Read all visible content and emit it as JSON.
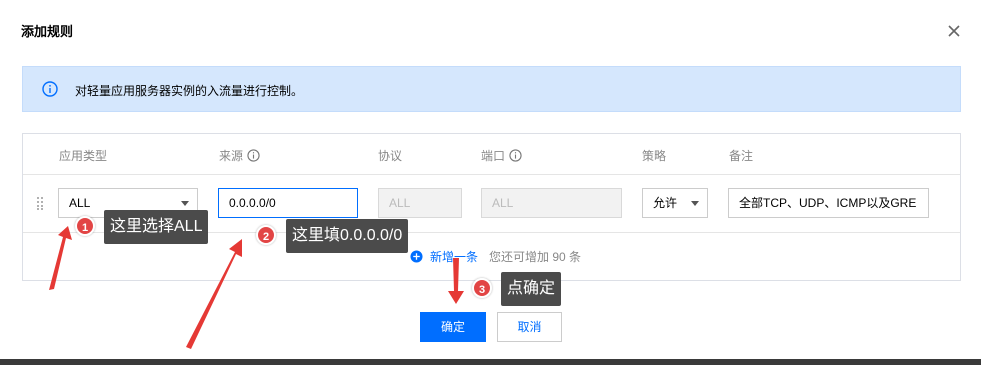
{
  "dialog": {
    "title": "添加规则",
    "info_text": "对轻量应用服务器实例的入流量进行控制。"
  },
  "table": {
    "headers": {
      "app_type": "应用类型",
      "source": "来源",
      "protocol": "协议",
      "port": "端口",
      "policy": "策略",
      "remark": "备注"
    },
    "row": {
      "app_type": "ALL",
      "source": "0.0.0.0/0",
      "protocol": "ALL",
      "port": "ALL",
      "policy": "允许",
      "remark": "全部TCP、UDP、ICMP以及GRE"
    },
    "add_link": "新增一条",
    "add_hint": "您还可增加 90 条"
  },
  "buttons": {
    "confirm": "确定",
    "cancel": "取消"
  },
  "annotations": [
    {
      "number": "1",
      "text": "这里选择ALL"
    },
    {
      "number": "2",
      "text": "这里填0.0.0.0/0"
    },
    {
      "number": "3",
      "text": "点确定"
    }
  ],
  "colors": {
    "primary": "#006eff",
    "info_bg": "#d5e7fd",
    "annotation_red": "#e24545",
    "tip_bg": "#4b4b4b"
  }
}
